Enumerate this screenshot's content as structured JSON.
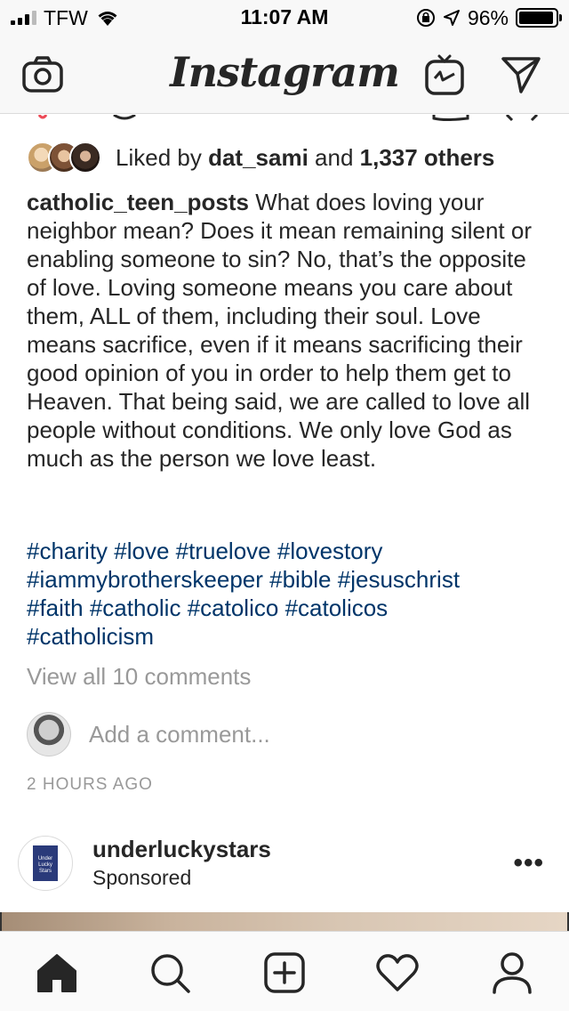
{
  "status_bar": {
    "carrier": "TFW",
    "time": "11:07 AM",
    "battery_percent": "96%",
    "icons": [
      "signal-bars-icon",
      "wifi-icon",
      "orientation-lock-icon",
      "location-arrow-icon",
      "battery-icon"
    ]
  },
  "nav": {
    "logo": "Instagram",
    "icons": [
      "camera-icon",
      "igtv-icon",
      "direct-message-icon"
    ]
  },
  "post": {
    "likes": {
      "prefix": "Liked by ",
      "user": "dat_sami",
      "middle": " and ",
      "count": "1,337 others"
    },
    "caption": {
      "username": "catholic_teen_posts",
      "text": " What does loving your neighbor mean? Does it mean remaining silent or enabling someone to sin? No, that’s the opposite of love. Loving someone means you care about them, ALL of them, including their soul. Love means sacrifice, even if it means sacrificing their good opinion of you in order to help them get to Heaven. That being said, we are called to love all people without conditions. We only love God as much as the person we love least."
    },
    "hashtags": [
      "#charity",
      "#love",
      "#truelove",
      "#lovestory",
      "#iammybrotherskeeper",
      "#bible",
      "#jesuschrist",
      "#faith",
      "#catholic",
      "#catolico",
      "#catolicos",
      "#catholicism"
    ],
    "view_comments": "View all 10 comments",
    "add_comment_placeholder": "Add a comment...",
    "timestamp": "2 HOURS AGO"
  },
  "next_post": {
    "username": "underluckystars",
    "label": "Sponsored",
    "avatar_text": "Under Lucky Stars",
    "more": "•••"
  },
  "tab_bar": {
    "items": [
      "home-icon",
      "search-icon",
      "new-post-icon",
      "activity-heart-icon",
      "profile-icon"
    ]
  },
  "colors": {
    "hashtag": "#003569",
    "muted": "#999999",
    "text": "#262626"
  }
}
